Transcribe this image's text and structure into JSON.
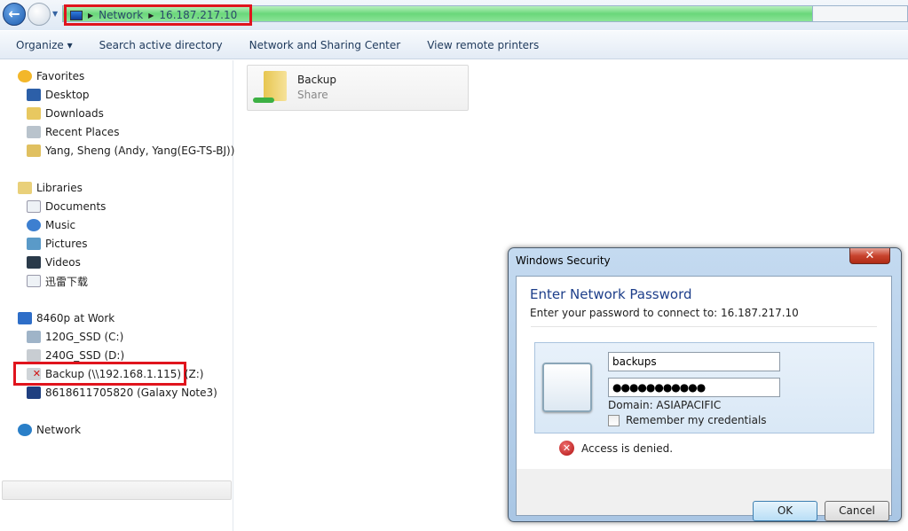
{
  "address": {
    "crumbs": [
      "Network",
      "16.187.217.10"
    ]
  },
  "toolbar": {
    "organize": "Organize ▾",
    "search_ad": "Search active directory",
    "network_center": "Network and Sharing Center",
    "remote_printers": "View remote printers"
  },
  "sidebar": {
    "favorites": {
      "label": "Favorites",
      "items": [
        "Desktop",
        "Downloads",
        "Recent Places",
        "Yang, Sheng (Andy, Yang(EG-TS-BJ))"
      ]
    },
    "libraries": {
      "label": "Libraries",
      "items": [
        "Documents",
        "Music",
        "Pictures",
        "Videos",
        "迅雷下载"
      ]
    },
    "computer": {
      "label": "8460p at Work",
      "items": [
        "120G_SSD (C:)",
        "240G_SSD (D:)",
        "Backup (\\\\192.168.1.115) (Z:)",
        "8618611705820 (Galaxy Note3)"
      ]
    },
    "network": "Network"
  },
  "content": {
    "share": {
      "name": "Backup",
      "type": "Share"
    }
  },
  "dialog": {
    "title": "Windows Security",
    "close": "✕",
    "heading": "Enter Network Password",
    "subtitle": "Enter your password to connect to: 16.187.217.10",
    "username": "backups",
    "password": "●●●●●●●●●●●",
    "domain": "Domain: ASIAPACIFIC",
    "remember": "Remember my credentials",
    "remember_checked": false,
    "error": "Access is denied.",
    "ok": "OK",
    "cancel": "Cancel"
  },
  "colors": {
    "highlight": "#e0141d",
    "address_progress": "#6ad77a",
    "heading": "#1d3e8a"
  }
}
